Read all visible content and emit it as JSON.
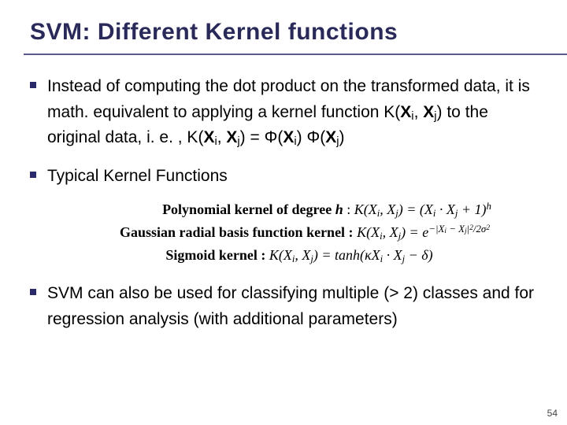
{
  "title": "SVM:  Different Kernel functions",
  "bullets": {
    "b1_part1": "Instead of computing the dot product on the transformed data, it is math. equivalent to applying a kernel function K(",
    "b1_xi": "X",
    "b1_i": "i",
    "b1_sep1": ", ",
    "b1_xj": "X",
    "b1_j": "j",
    "b1_part2": ") to the original data, i. e. , K(",
    "b1_xi2": "X",
    "b1_i2": "i",
    "b1_sep2": ", ",
    "b1_xj2": "X",
    "b1_j2": "j",
    "b1_eq": ") = Φ(",
    "b1_xi3": "X",
    "b1_i3": "i",
    "b1_mid": ") Φ(",
    "b1_xj3": "X",
    "b1_j3": "j",
    "b1_end": ")",
    "b2": "Typical Kernel Functions",
    "b3": "SVM can also be used for classifying multiple (> 2) classes and for regression analysis (with additional parameters)"
  },
  "kernels": {
    "poly_label": "Polynomial kernel of degree ",
    "poly_h": "h",
    "poly_sep": " :    ",
    "poly_lhs": "K(X",
    "poly_i": "i",
    "poly_mid1": ", X",
    "poly_j": "j",
    "poly_mid2": ") = (X",
    "poly_i2": "i",
    "poly_dot": " · X",
    "poly_j2": "j",
    "poly_plus": " + 1)",
    "poly_exp": "h",
    "gauss_label": "Gaussian radial basis function kernel :    ",
    "gauss_lhs": "K(X",
    "gauss_i": "i",
    "gauss_mid1": ", X",
    "gauss_j": "j",
    "gauss_mid2": ") = e",
    "gauss_exp1": "−|X",
    "gauss_exp_i": "i",
    "gauss_exp_mid": " − X",
    "gauss_exp_j": "j",
    "gauss_exp2": "|",
    "gauss_exp_sq": "2",
    "gauss_exp_den": "/2σ",
    "gauss_exp_s2": "2",
    "sig_label": "Sigmoid kernel :    ",
    "sig_lhs": "K(X",
    "sig_i": "i",
    "sig_mid1": ", X",
    "sig_j": "j",
    "sig_mid2": ") = tanh(κX",
    "sig_i2": "i",
    "sig_dot": " · X",
    "sig_j2": "j",
    "sig_end": " − δ)"
  },
  "page_number": "54"
}
